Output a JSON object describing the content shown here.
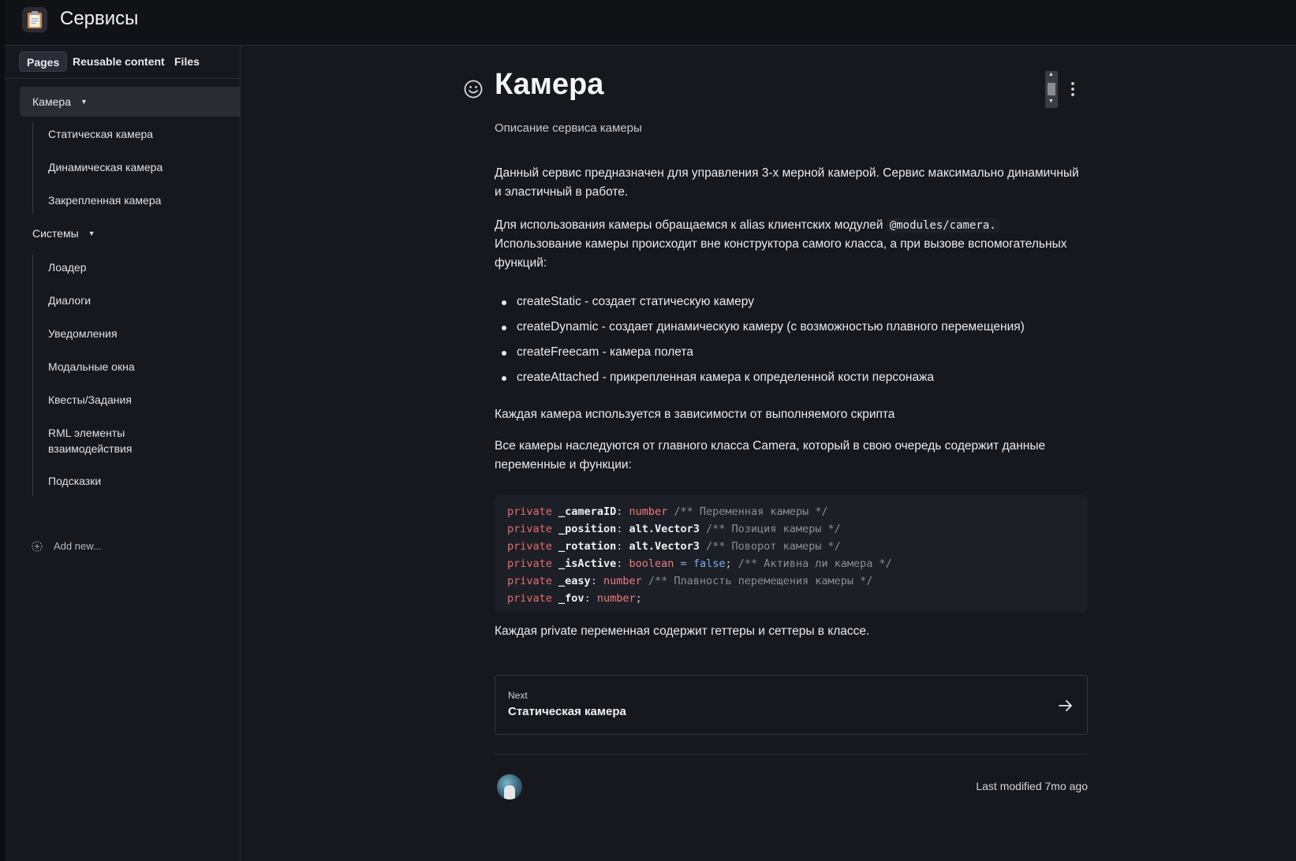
{
  "header": {
    "space_title": "Сервисы",
    "space_icon": "clipboard-icon"
  },
  "sidebar": {
    "tabs": [
      "Pages",
      "Reusable content",
      "Files"
    ],
    "active_tab": "Pages",
    "groups": [
      {
        "label": "Камера",
        "selected": true,
        "items": [
          "Статическая камера",
          "Динамическая камера",
          "Закрепленная камера"
        ]
      },
      {
        "label": "Системы",
        "selected": false,
        "items": [
          "Лоадер",
          "Диалоги",
          "Уведомления",
          "Модальные окна",
          "Квесты/Задания",
          "RML элементы взаимодействия",
          "Подсказки"
        ]
      }
    ],
    "add_new": "Add new..."
  },
  "page": {
    "title": "Камера",
    "description": "Описание сервиса камеры",
    "para1": "Данный сервис предназначен для управления 3-х мерной камерой. Сервис максимально динамичный и эластичный в работе.",
    "para2_prefix": "Для использования камеры обращаемся к alias клиентских модулей ",
    "para2_code": "@modules/camera.",
    "para2_suffix": " Использование камеры происходит вне конструктора самого класса, а при вызове вспомогательных функций:",
    "bullets": [
      "createStatic - создает статическую камеру",
      "createDynamic - создает динамическую камеру (с возможностью плавного перемещения)",
      "createFreecam - камера полета",
      "createAttached - прикрепленная камера к определенной кости персонажа"
    ],
    "para3": "Каждая камера используется в зависимости от выполняемого скрипта",
    "para4": "Все камеры наследуются от главного класса Camera, который в свою очередь содержит данные переменные и функции:",
    "code_lines": [
      "private _cameraID: number /** Переменная камеры */",
      "private _position: alt.Vector3 /** Позиция камеры */",
      "private _rotation: alt.Vector3 /** Поворот камеры */",
      "private _isActive: boolean = false; /** Активна ли камера */",
      "private _easy: number /** Плавность перемещения камеры */",
      "private _fov: number;"
    ],
    "para5": "Каждая private переменная содержит геттеры и сеттеры в классе.",
    "next": {
      "label": "Next",
      "title": "Статическая камера"
    },
    "last_modified": "Last modified 7mo ago"
  },
  "colors": {
    "background": "#16181d",
    "keyword": "#e66d6d",
    "boolean": "#78aef2",
    "comment": "#8a8e97"
  }
}
